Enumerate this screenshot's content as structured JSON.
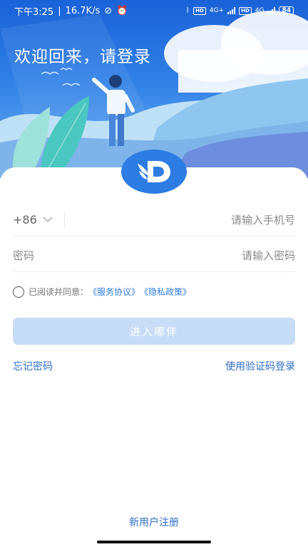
{
  "status_bar": {
    "time": "下午3:25",
    "speed": "16.7K/s",
    "network_1": "4G+",
    "network_2": "4G",
    "hd_1": "HD",
    "hd_2": "HD",
    "battery": "84"
  },
  "hero": {
    "welcome": "欢迎回来，请登录"
  },
  "form": {
    "country_code": "+86",
    "phone_placeholder": "请输入手机号",
    "password_label": "密码",
    "password_placeholder": "请输入密码",
    "agree_text": "已阅读并同意：",
    "service_link": "《服务协议》",
    "privacy_link": "《隐私政策》",
    "enter_button": "进入嘟伴",
    "forgot_password": "忘记密码",
    "code_login": "使用验证码登录",
    "register": "新用户注册"
  },
  "colors": {
    "accent": "#2d7ce4",
    "button_disabled": "#c7ddf7",
    "hero_top": "#1a62d8"
  }
}
